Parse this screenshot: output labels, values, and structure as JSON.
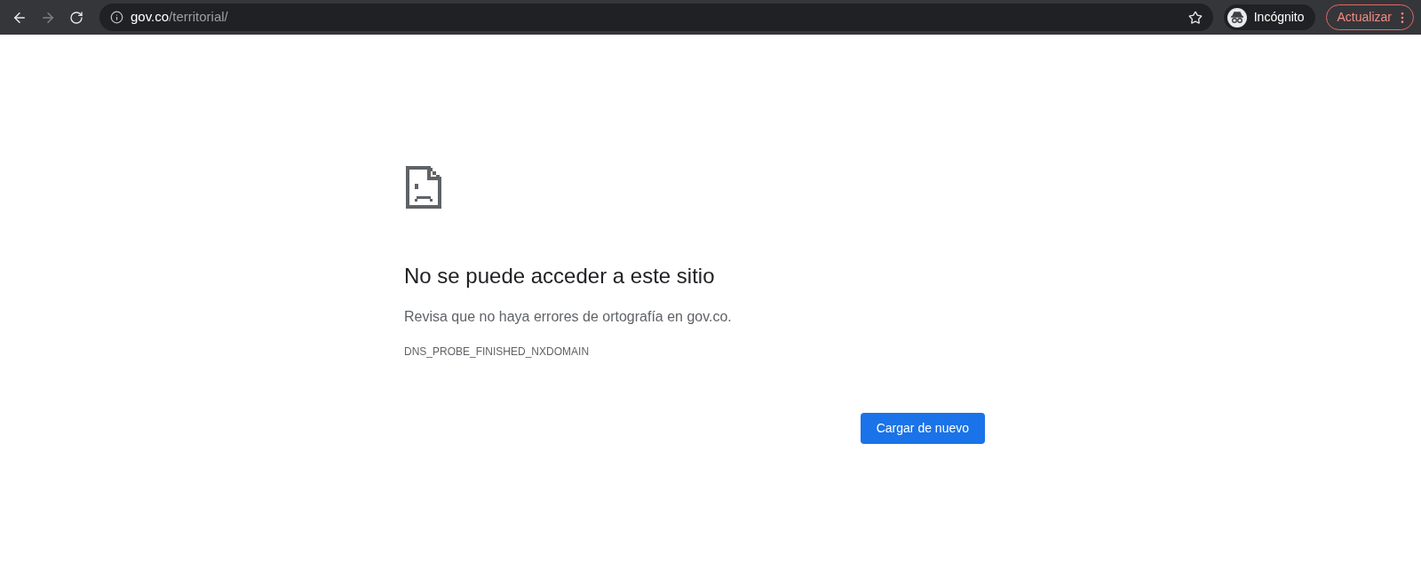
{
  "toolbar": {
    "url_host": "gov.co",
    "url_path": "/territorial/",
    "forward_disabled": true,
    "profile_label": "Incógnito",
    "update_label": "Actualizar"
  },
  "error": {
    "title": "No se puede acceder a este sitio",
    "message": "Revisa que no haya errores de ortografía en gov.co.",
    "code": "DNS_PROBE_FINISHED_NXDOMAIN",
    "button": "Cargar de nuevo"
  }
}
